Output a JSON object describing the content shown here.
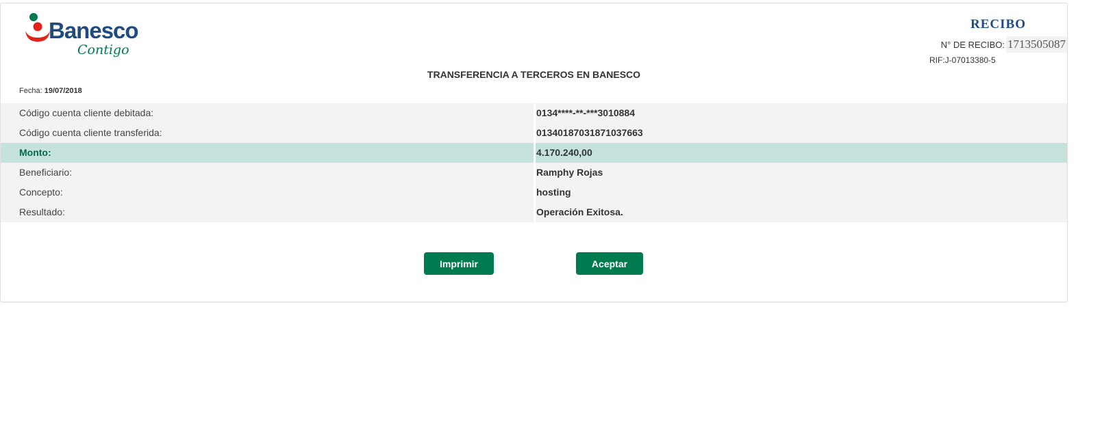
{
  "brand": {
    "name": "Banesco",
    "tagline": "Contigo",
    "colors": {
      "blue": "#1e4c82",
      "green": "#007a4f",
      "red": "#e2231a"
    }
  },
  "receipt": {
    "title": "RECIBO",
    "number_label": "N° DE RECIBO:",
    "number": "1713505087",
    "rif": "RIF:J-07013380-5"
  },
  "heading": "TRANSFERENCIA A TERCEROS EN BANESCO",
  "date": {
    "label": "Fecha:",
    "value": "19/07/2018"
  },
  "details": [
    {
      "label": "Código cuenta cliente debitada:",
      "value": "0134****-**-***3010884"
    },
    {
      "label": "Código cuenta cliente transferida:",
      "value": "01340187031871037663"
    },
    {
      "label": "Monto:",
      "value": "4.170.240,00",
      "highlight": true
    },
    {
      "label": "Beneficiario:",
      "value": "Ramphy Rojas"
    },
    {
      "label": "Concepto:",
      "value": "hosting"
    },
    {
      "label": "Resultado:",
      "value": "Operación Exitosa."
    }
  ],
  "buttons": {
    "print": "Imprimir",
    "accept": "Aceptar"
  }
}
